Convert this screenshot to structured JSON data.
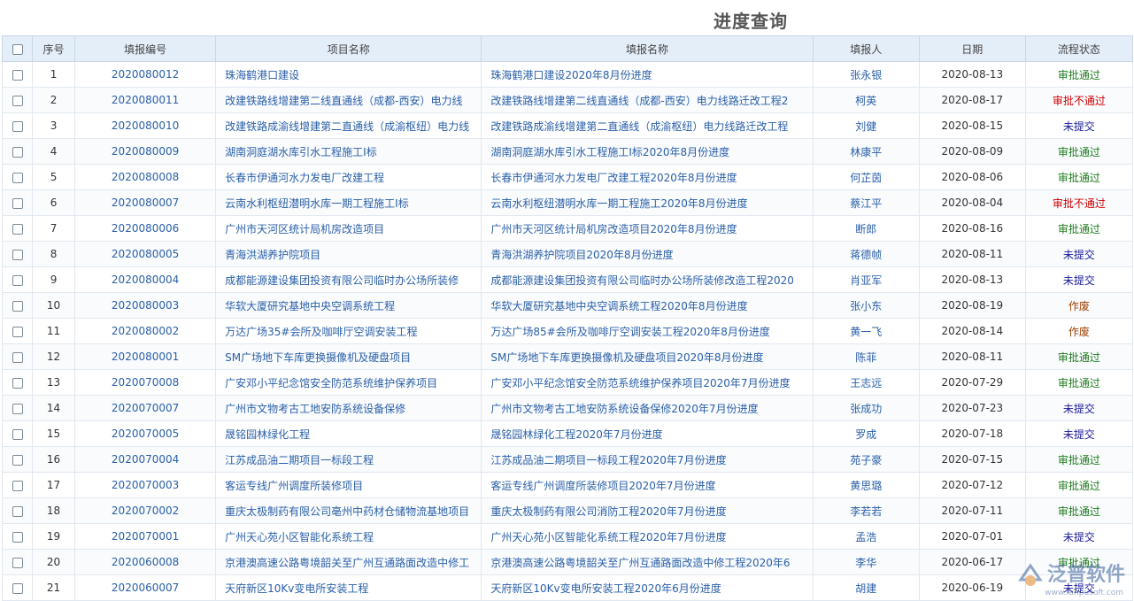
{
  "page": {
    "title": "进度查询"
  },
  "columns": [
    "序号",
    "填报编号",
    "项目名称",
    "填报名称",
    "填报人",
    "日期",
    "流程状态"
  ],
  "rows": [
    {
      "no": "1",
      "code": "2020080012",
      "project": "珠海鹤港口建设",
      "report": "珠海鹤港口建设2020年8月份进度",
      "person": "张永银",
      "date": "2020-08-13",
      "status": "审批通过",
      "st": "ok"
    },
    {
      "no": "2",
      "code": "2020080011",
      "project": "改建铁路线增建第二线直通线（成都-西安）电力线",
      "report": "改建铁路线增建第二线直通线（成都-西安）电力线路迁改工程2",
      "person": "柯英",
      "date": "2020-08-17",
      "status": "审批不通过",
      "st": "bad"
    },
    {
      "no": "3",
      "code": "2020080010",
      "project": "改建铁路成渝线增建第二直通线（成渝枢纽）电力线",
      "report": "改建铁路成渝线增建第二直通线（成渝枢纽）电力线路迁改工程",
      "person": "刘健",
      "date": "2020-08-15",
      "status": "未提交",
      "st": "none"
    },
    {
      "no": "4",
      "code": "2020080009",
      "project": "湖南洞庭湖水库引水工程施工I标",
      "report": "湖南洞庭湖水库引水工程施工I标2020年8月份进度",
      "person": "林康平",
      "date": "2020-08-09",
      "status": "审批通过",
      "st": "ok"
    },
    {
      "no": "5",
      "code": "2020080008",
      "project": "长春市伊通河水力发电厂改建工程",
      "report": "长春市伊通河水力发电厂改建工程2020年8月份进度",
      "person": "何芷茵",
      "date": "2020-08-06",
      "status": "审批通过",
      "st": "ok"
    },
    {
      "no": "6",
      "code": "2020080007",
      "project": "云南水利枢纽潜明水库一期工程施工I标",
      "report": "云南水利枢纽潜明水库一期工程施工2020年8月份进度",
      "person": "蔡江平",
      "date": "2020-08-04",
      "status": "审批不通过",
      "st": "bad"
    },
    {
      "no": "7",
      "code": "2020080006",
      "project": "广州市天河区统计局机房改造项目",
      "report": "广州市天河区统计局机房改造项目2020年8月份进度",
      "person": "断郎",
      "date": "2020-08-16",
      "status": "审批通过",
      "st": "ok"
    },
    {
      "no": "8",
      "code": "2020080005",
      "project": "青海洪湖养护院项目",
      "report": "青海洪湖养护院项目2020年8月份进度",
      "person": "蒋德帧",
      "date": "2020-08-11",
      "status": "未提交",
      "st": "none"
    },
    {
      "no": "9",
      "code": "2020080004",
      "project": "成都能源建设集团投资有限公司临时办公场所装修",
      "report": "成都能源建设集团投资有限公司临时办公场所装修改造工程2020",
      "person": "肖亚军",
      "date": "2020-08-13",
      "status": "未提交",
      "st": "none"
    },
    {
      "no": "10",
      "code": "2020080003",
      "project": "华软大厦研究基地中央空调系统工程",
      "report": "华软大厦研究基地中央空调系统工程2020年8月份进度",
      "person": "张小东",
      "date": "2020-08-19",
      "status": "作废",
      "st": "void"
    },
    {
      "no": "11",
      "code": "2020080002",
      "project": "万达广场35#会所及咖啡厅空调安装工程",
      "report": "万达广场85#会所及咖啡厅空调安装工程2020年8月份进度",
      "person": "黄一飞",
      "date": "2020-08-14",
      "status": "作废",
      "st": "void"
    },
    {
      "no": "12",
      "code": "2020080001",
      "project": "SM广场地下车库更换摄像机及硬盘项目",
      "report": "SM广场地下车库更换摄像机及硬盘项目2020年8月份进度",
      "person": "陈菲",
      "date": "2020-08-11",
      "status": "审批通过",
      "st": "ok"
    },
    {
      "no": "13",
      "code": "2020070008",
      "project": "广安邓小平纪念馆安全防范系统维护保养项目",
      "report": "广安邓小平纪念馆安全防范系统维护保养项目2020年7月份进度",
      "person": "王志远",
      "date": "2020-07-29",
      "status": "审批通过",
      "st": "ok"
    },
    {
      "no": "14",
      "code": "2020070007",
      "project": "广州市文物考古工地安防系统设备保修",
      "report": "广州市文物考古工地安防系统设备保修2020年7月份进度",
      "person": "张成功",
      "date": "2020-07-23",
      "status": "未提交",
      "st": "none"
    },
    {
      "no": "15",
      "code": "2020070005",
      "project": "晟铭园林绿化工程",
      "report": "晟铭园林绿化工程2020年7月份进度",
      "person": "罗成",
      "date": "2020-07-18",
      "status": "未提交",
      "st": "none"
    },
    {
      "no": "16",
      "code": "2020070004",
      "project": "江苏成品油二期项目一标段工程",
      "report": "江苏成品油二期项目一标段工程2020年7月份进度",
      "person": "苑子豪",
      "date": "2020-07-15",
      "status": "审批通过",
      "st": "ok"
    },
    {
      "no": "17",
      "code": "2020070003",
      "project": "客运专线广州调度所装修项目",
      "report": "客运专线广州调度所装修项目2020年7月份进度",
      "person": "黄思璐",
      "date": "2020-07-12",
      "status": "审批通过",
      "st": "ok"
    },
    {
      "no": "18",
      "code": "2020070002",
      "project": "重庆太极制药有限公司亳州中药材仓储物流基地项目",
      "report": "重庆太极制药有限公司消防工程2020年7月份进度",
      "person": "李若若",
      "date": "2020-07-11",
      "status": "审批通过",
      "st": "ok"
    },
    {
      "no": "19",
      "code": "2020070001",
      "project": "广州天心苑小区智能化系统工程",
      "report": "广州天心苑小区智能化系统工程2020年7月份进度",
      "person": "孟浩",
      "date": "2020-07-01",
      "status": "未提交",
      "st": "none"
    },
    {
      "no": "20",
      "code": "2020060008",
      "project": "京港澳高速公路粤境韶关至广州互通路面改造中修工",
      "report": "京港澳高速公路粤境韶关至广州互通路面改造中修工程2020年6",
      "person": "李华",
      "date": "2020-06-17",
      "status": "审批通过",
      "st": "ok"
    },
    {
      "no": "21",
      "code": "2020060007",
      "project": "天府新区10Kv变电所安装工程",
      "report": "天府新区10Kv变电所安装工程2020年6月份进度",
      "person": "胡建",
      "date": "2020-06-19",
      "status": "未提交",
      "st": "none"
    }
  ],
  "watermark": {
    "brand": "泛普软件",
    "url": "www.fanpusoft.com"
  },
  "colors": {
    "approved": "#1f7a1f",
    "rejected": "#d00000",
    "unsubmitted": "#1a1a9a",
    "void": "#a04000",
    "link": "#2a5fa8"
  }
}
